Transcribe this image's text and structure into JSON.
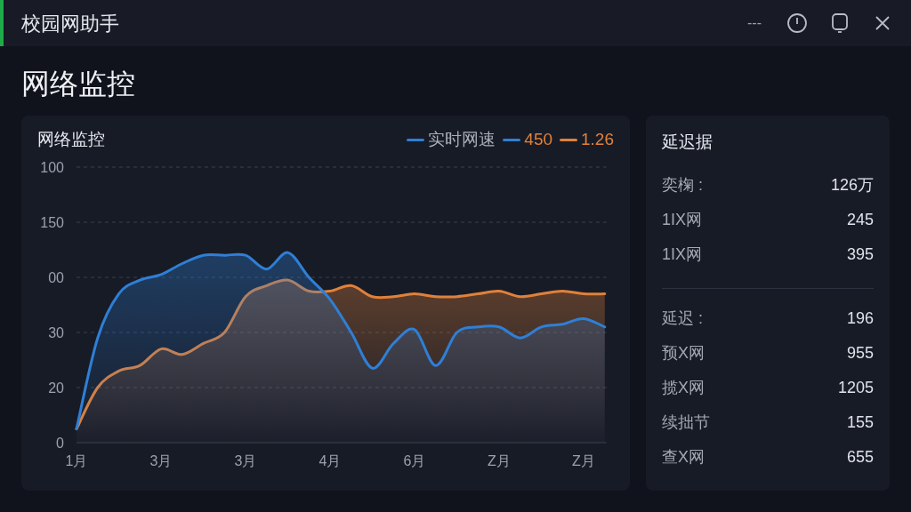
{
  "window": {
    "title": "校园网助手",
    "controls": [
      "---"
    ]
  },
  "page_title": "网络监控",
  "chart_panel": {
    "title": "网络监控",
    "legend": [
      {
        "label": "实时网速",
        "color": "#2f7fd6",
        "kind": "name"
      },
      {
        "label": "450",
        "color": "#2f7fd6",
        "kind": "value"
      },
      {
        "label": "1.26",
        "color": "#e0813a",
        "kind": "value"
      }
    ],
    "y_axis_labels": [
      "100",
      "150",
      "00",
      "30",
      "20",
      "0"
    ],
    "x_axis_labels": [
      "1月",
      "3月",
      "3月",
      "4月",
      "6月",
      "Z月",
      "Z月"
    ]
  },
  "stats_panel": {
    "title": "延迟据",
    "groups": [
      [
        {
          "label": "奕椈 :",
          "value": "126万"
        },
        {
          "label": "1IX网",
          "value": "245"
        },
        {
          "label": "1IX网",
          "value": "395"
        }
      ],
      [
        {
          "label": "延迟 :",
          "value": "196"
        },
        {
          "label": "预X网",
          "value": "955"
        },
        {
          "label": "揽X网",
          "value": "1205"
        },
        {
          "label": "续拙节",
          "value": "155"
        },
        {
          "label": "查X网",
          "value": "655"
        }
      ]
    ]
  }
}
